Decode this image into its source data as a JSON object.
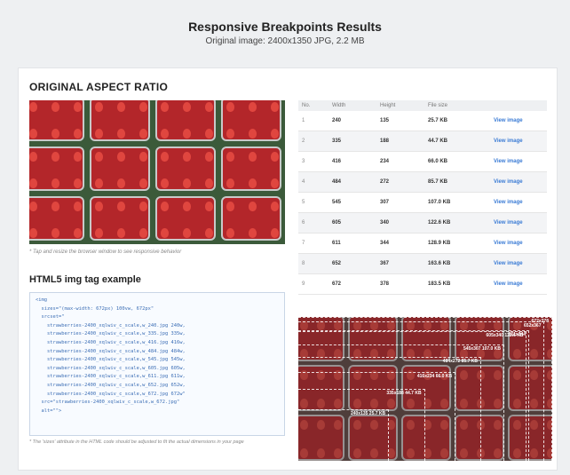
{
  "header": {
    "title": "Responsive Breakpoints Results",
    "subtitle": "Original image: 2400x1350 JPG, 2.2 MB"
  },
  "original": {
    "title": "ORIGINAL ASPECT RATIO",
    "caption": "* Tap and resize the browser window to see responsive behavior"
  },
  "html5": {
    "title": "HTML5 img tag example",
    "code": "<img\n  sizes=\"(max-width: 672px) 100vw, 672px\"\n  srcset=\"\n    strawberries-2400_xqlwiv_c_scale,w_240.jpg 240w,\n    strawberries-2400_xqlwiv_c_scale,w_335.jpg 335w,\n    strawberries-2400_xqlwiv_c_scale,w_416.jpg 416w,\n    strawberries-2400_xqlwiv_c_scale,w_484.jpg 484w,\n    strawberries-2400_xqlwiv_c_scale,w_545.jpg 545w,\n    strawberries-2400_xqlwiv_c_scale,w_605.jpg 605w,\n    strawberries-2400_xqlwiv_c_scale,w_611.jpg 611w,\n    strawberries-2400_xqlwiv_c_scale,w_652.jpg 652w,\n    strawberries-2400_xqlwiv_c_scale,w_672.jpg 672w\"\n  src=\"strawberries-2400_xqlwiv_c_scale,w_672.jpg\"\n  alt=\"\">",
    "note": "* The 'sizes' attribute in the HTML code should be adjusted to fit the actual dimensions in your page"
  },
  "table": {
    "headers": [
      "No.",
      "Width",
      "Height",
      "File size",
      ""
    ],
    "rows": [
      {
        "no": "1",
        "width": "240",
        "height": "135",
        "size": "25.7 KB",
        "link": "View image"
      },
      {
        "no": "2",
        "width": "335",
        "height": "188",
        "size": "44.7 KB",
        "link": "View image"
      },
      {
        "no": "3",
        "width": "416",
        "height": "234",
        "size": "66.0 KB",
        "link": "View image"
      },
      {
        "no": "4",
        "width": "484",
        "height": "272",
        "size": "85.7 KB",
        "link": "View image"
      },
      {
        "no": "5",
        "width": "545",
        "height": "307",
        "size": "107.0 KB",
        "link": "View image"
      },
      {
        "no": "6",
        "width": "605",
        "height": "340",
        "size": "122.6 KB",
        "link": "View image"
      },
      {
        "no": "7",
        "width": "611",
        "height": "344",
        "size": "128.9 KB",
        "link": "View image"
      },
      {
        "no": "8",
        "width": "652",
        "height": "367",
        "size": "163.6 KB",
        "link": "View image"
      },
      {
        "no": "9",
        "width": "672",
        "height": "378",
        "size": "183.5 KB",
        "link": "View image"
      }
    ]
  },
  "breakpoints": [
    {
      "label": "240x135 25.7 KB",
      "w": 240
    },
    {
      "label": "335x188 44.7 KB",
      "w": 335
    },
    {
      "label": "416x234 66.0 KB",
      "w": 416
    },
    {
      "label": "484x272 85.7 KB",
      "w": 484
    },
    {
      "label": "545x307 107.0 KB",
      "w": 545
    },
    {
      "label": "605x340 122.6 KB",
      "w": 605
    },
    {
      "label": "611x344",
      "w": 611
    },
    {
      "label": "652x367",
      "w": 652
    },
    {
      "label": "672x378",
      "w": 672
    }
  ]
}
